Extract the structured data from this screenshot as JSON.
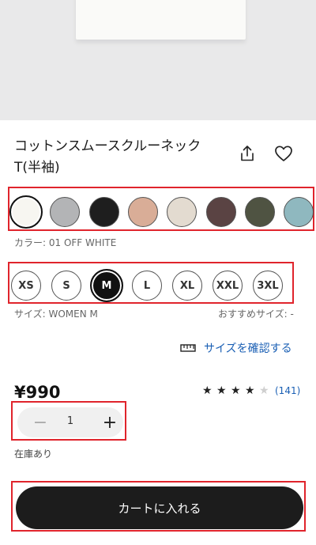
{
  "product": {
    "title_line1": "コットンスムースクルーネック",
    "title_line2": "T(半袖)",
    "price": "¥990",
    "rating": 4,
    "rating_max": 5,
    "review_count": "(141)"
  },
  "colors": {
    "caption": "カラー: 01 OFF WHITE",
    "swatches": [
      "#f7f6f1",
      "#b3b4b6",
      "#1e1e1e",
      "#d9ad97",
      "#e3dbd0",
      "#5a4343",
      "#4f5342",
      "#8fb8bf"
    ],
    "selected_index": 0
  },
  "sizes": {
    "options": [
      "XS",
      "S",
      "M",
      "L",
      "XL",
      "XXL",
      "3XL"
    ],
    "selected_index": 2,
    "caption": "サイズ: WOMEN M",
    "recommended": "おすすめサイズ: -",
    "check_label": "サイズを確認する"
  },
  "quantity": {
    "value": "1",
    "minus_symbol": "−",
    "plus_symbol": "+"
  },
  "stock_text": "在庫あり",
  "cart_button_label": "カートに入れる",
  "accent_colors": {
    "link": "#1a5fb4",
    "highlight": "#e0242c",
    "button": "#1c1c1c"
  }
}
